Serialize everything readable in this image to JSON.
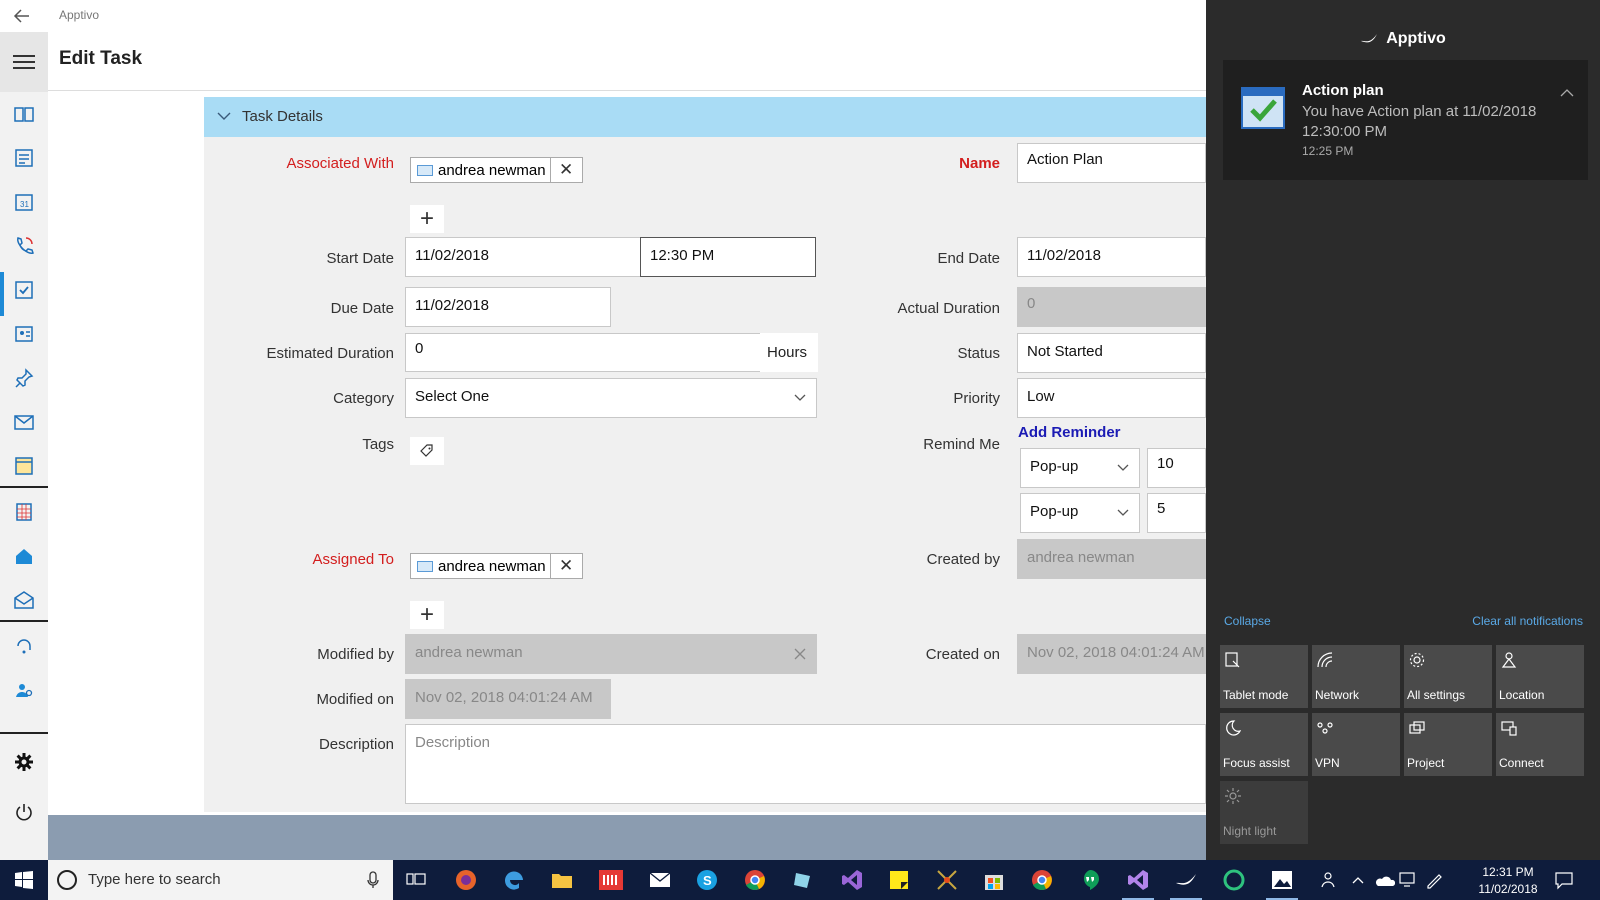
{
  "app": {
    "title": "Apptivo",
    "page_title": "Edit Task"
  },
  "section": {
    "title": "Task Details"
  },
  "form": {
    "associated_with": {
      "label": "Associated With",
      "chip": "andrea newman"
    },
    "name": {
      "label": "Name",
      "value": "Action Plan"
    },
    "start_date": {
      "label": "Start Date",
      "date": "11/02/2018",
      "time": "12:30 PM"
    },
    "end_date": {
      "label": "End Date",
      "value": "11/02/2018"
    },
    "due_date": {
      "label": "Due Date",
      "value": "11/02/2018"
    },
    "actual_duration": {
      "label": "Actual Duration",
      "value": "0"
    },
    "estimated_duration": {
      "label": "Estimated Duration",
      "value": "0",
      "unit": "Hours"
    },
    "status": {
      "label": "Status",
      "value": "Not Started"
    },
    "category": {
      "label": "Category",
      "value": "Select One"
    },
    "priority": {
      "label": "Priority",
      "value": "Low"
    },
    "tags": {
      "label": "Tags"
    },
    "remind_me": {
      "label": "Remind Me",
      "add_label": "Add Reminder",
      "reminders": [
        {
          "type": "Pop-up",
          "value": "10"
        },
        {
          "type": "Pop-up",
          "value": "5"
        }
      ]
    },
    "assigned_to": {
      "label": "Assigned To",
      "chip": "andrea newman"
    },
    "created_by": {
      "label": "Created by",
      "value": "andrea newman"
    },
    "modified_by": {
      "label": "Modified by",
      "value": "andrea newman"
    },
    "created_on": {
      "label": "Created on",
      "value": "Nov 02, 2018 04:01:24 AM"
    },
    "modified_on": {
      "label": "Modified on",
      "value": "Nov 02, 2018 04:01:24 AM"
    },
    "description": {
      "label": "Description",
      "placeholder": "Description"
    }
  },
  "action_center": {
    "app_name": "Apptivo",
    "notification": {
      "title": "Action plan",
      "body": "You have Action plan at 11/02/2018 12:30:00 PM",
      "time": "12:25 PM"
    },
    "collapse_label": "Collapse",
    "clear_label": "Clear all notifications",
    "tiles": [
      {
        "label": "Tablet mode",
        "icon": "tablet-mode-icon",
        "on": true
      },
      {
        "label": "Network",
        "icon": "network-icon",
        "on": true
      },
      {
        "label": "All settings",
        "icon": "settings-icon",
        "on": true
      },
      {
        "label": "Location",
        "icon": "location-icon",
        "on": true
      },
      {
        "label": "Focus assist",
        "icon": "focus-assist-icon",
        "on": true
      },
      {
        "label": "VPN",
        "icon": "vpn-icon",
        "on": true
      },
      {
        "label": "Project",
        "icon": "project-icon",
        "on": true
      },
      {
        "label": "Connect",
        "icon": "connect-icon",
        "on": true
      },
      {
        "label": "Night light",
        "icon": "night-light-icon",
        "on": false
      }
    ]
  },
  "taskbar": {
    "search_placeholder": "Type here to search",
    "time": "12:31 PM",
    "date": "11/02/2018"
  },
  "colors": {
    "section_header": "#a9dcf5",
    "required_label": "#d31e1e",
    "link": "#1b1bb4",
    "accent": "#1e8ad6",
    "action_center_bg": "#2b2b2b",
    "taskbar_bg": "#0e1c3c"
  }
}
